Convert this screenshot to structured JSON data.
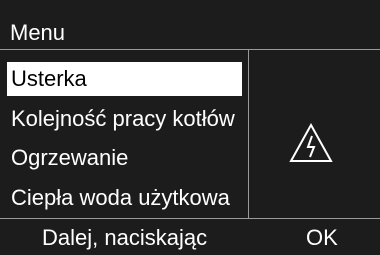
{
  "header": {
    "title": "Menu"
  },
  "menu": {
    "items": [
      {
        "label": "Usterka",
        "selected": true
      },
      {
        "label": "Kolejność pracy kotłów",
        "selected": false
      },
      {
        "label": "Ogrzewanie",
        "selected": false
      },
      {
        "label": "Ciepła woda użytkowa",
        "selected": false
      }
    ]
  },
  "status": {
    "icon": "warning-triangle-icon"
  },
  "footer": {
    "hint": "Dalej, naciskając",
    "ok_label": "OK"
  },
  "colors": {
    "background": "#1c1c1c",
    "text": "#ffffff",
    "selection": "#ffffff",
    "divider": "#9a9a9a"
  }
}
